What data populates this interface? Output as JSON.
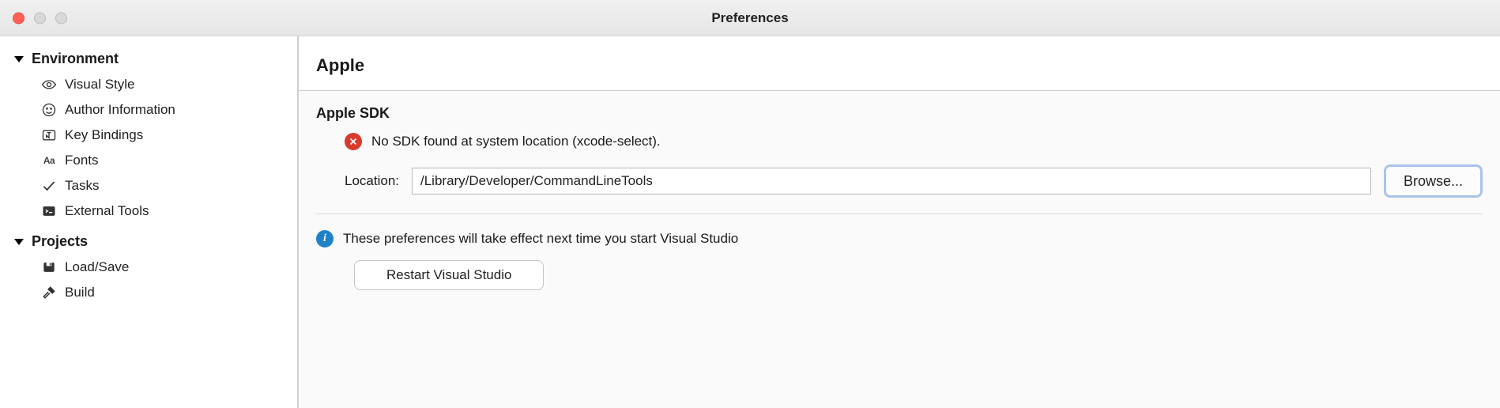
{
  "window": {
    "title": "Preferences"
  },
  "sidebar": {
    "sections": [
      {
        "label": "Environment",
        "items": [
          {
            "label": "Visual Style",
            "icon": "eye"
          },
          {
            "label": "Author Information",
            "icon": "smiley"
          },
          {
            "label": "Key Bindings",
            "icon": "keycap"
          },
          {
            "label": "Fonts",
            "icon": "fonts"
          },
          {
            "label": "Tasks",
            "icon": "check"
          },
          {
            "label": "External Tools",
            "icon": "terminal"
          }
        ]
      },
      {
        "label": "Projects",
        "items": [
          {
            "label": "Load/Save",
            "icon": "disk"
          },
          {
            "label": "Build",
            "icon": "hammer"
          }
        ]
      }
    ]
  },
  "content": {
    "title": "Apple",
    "sdk": {
      "group_title": "Apple SDK",
      "error_msg": "No SDK found at system location (xcode-select).",
      "location_label": "Location:",
      "location_value": "/Library/Developer/CommandLineTools",
      "browse_label": "Browse..."
    },
    "restart": {
      "info_msg": "These preferences will take effect next time you start Visual Studio",
      "button_label": "Restart Visual Studio"
    }
  }
}
